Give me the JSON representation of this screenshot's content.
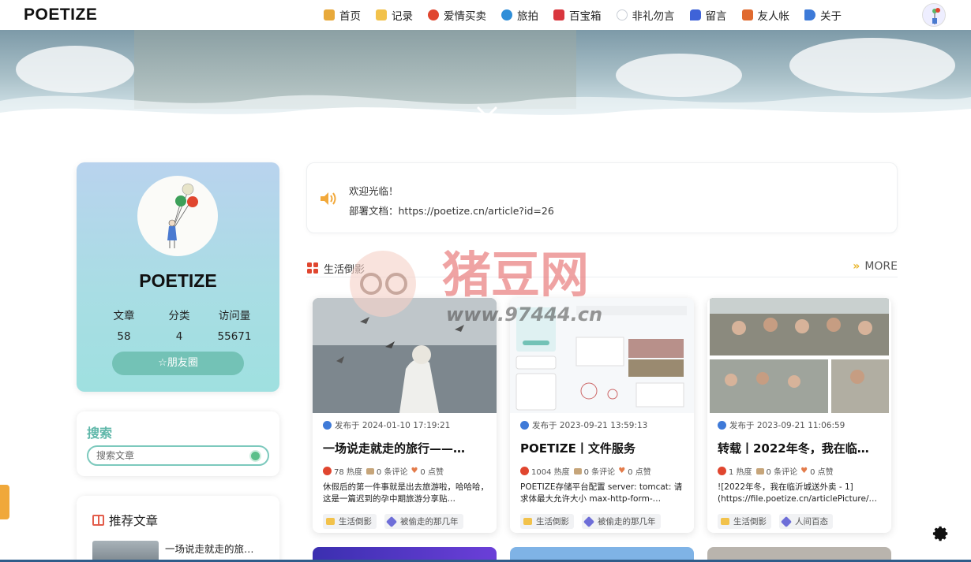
{
  "site": {
    "logo": "POETIZE"
  },
  "nav": {
    "items": [
      {
        "label": "首页",
        "icon": "home-icon",
        "color": "#e8a93a"
      },
      {
        "label": "记录",
        "icon": "note-icon",
        "color": "#f2c24b"
      },
      {
        "label": "爱情买卖",
        "icon": "love-icon",
        "color": "#e0462f"
      },
      {
        "label": "旅拍",
        "icon": "globe-icon",
        "color": "#2f8ed8"
      },
      {
        "label": "百宝箱",
        "icon": "toolbox-icon",
        "color": "#d9363e"
      },
      {
        "label": "非礼勿言",
        "icon": "speech-bubble-icon",
        "color": "#c9ced6"
      },
      {
        "label": "留言",
        "icon": "message-icon",
        "color": "#3f63d8"
      },
      {
        "label": "友人帐",
        "icon": "friends-icon",
        "color": "#e06a2f"
      },
      {
        "label": "关于",
        "icon": "about-icon",
        "color": "#3d7ad8"
      }
    ]
  },
  "profile": {
    "name": "POETIZE",
    "stats": [
      {
        "label": "文章",
        "value": "58"
      },
      {
        "label": "分类",
        "value": "4"
      },
      {
        "label": "访问量",
        "value": "55671"
      }
    ],
    "friend_button": "☆朋友圈"
  },
  "search": {
    "title": "搜索",
    "placeholder": "搜索文章"
  },
  "recommend": {
    "title": "推荐文章",
    "items": [
      {
        "title": "一场说走就走的旅…"
      }
    ]
  },
  "notice": {
    "line1": "欢迎光临！",
    "line2": "部署文档：https://poetize.cn/article?id=26"
  },
  "section": {
    "title": "生活倒影",
    "more": "MORE"
  },
  "articles": [
    {
      "date": "发布于 2024-01-10 17:19:21",
      "title": "一场说走就走的旅行——…",
      "heat": "78 热度",
      "comments": "0 条评论",
      "likes": "0 点赞",
      "excerpt": "休假后的第一件事就是出去旅游啦，哈哈哈，这是一篇迟到的孕中期旅游分享贴…",
      "tags": [
        "生活倒影",
        "被偷走的那几年"
      ]
    },
    {
      "date": "发布于 2023-09-21 13:59:13",
      "title": "POETIZE丨文件服务",
      "heat": "1004 热度",
      "comments": "0 条评论",
      "likes": "0 点赞",
      "excerpt": "POETIZE存储平台配置 server: tomcat: 请求体最大允许大小 max-http-form-…",
      "tags": [
        "生活倒影",
        "被偷走的那几年"
      ]
    },
    {
      "date": "发布于 2023-09-21 11:06:59",
      "title": "转载丨2022年冬，我在临…",
      "heat": "1 热度",
      "comments": "0 条评论",
      "likes": "0 点赞",
      "excerpt": "![2022年冬，我在临沂城送外卖 - 1](https://file.poetize.cn/articlePicture/…",
      "tags": [
        "生活倒影",
        "人间百态"
      ]
    }
  ],
  "watermark": {
    "name": "猪豆网",
    "url": "www.97444.cn"
  },
  "side_tab": "",
  "colors": {
    "accent": "#73c2b6",
    "search_green": "#5fb7a9"
  }
}
